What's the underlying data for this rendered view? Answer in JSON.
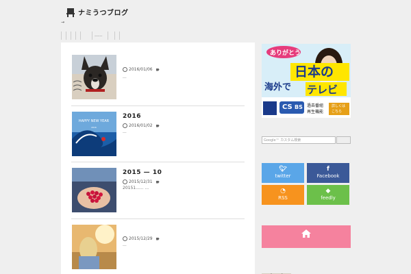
{
  "header": {
    "title": "ナミうつブログ",
    "tagline": "→",
    "nav_items": [
      "",
      "",
      "",
      "",
      "",
      "......",
      "",
      ""
    ]
  },
  "posts": [
    {
      "title": "",
      "date": "2016/01/06",
      "excerpt": "...",
      "thumb": "french-bulldog-image"
    },
    {
      "title": "2016",
      "date": "2016/01/02",
      "excerpt": "...",
      "thumb": "happy-new-year-wave-image"
    },
    {
      "title": "2015 — 10",
      "date": "2015/12/31",
      "excerpt": "20151...... ...",
      "thumb": "raspberries-in-hands-image"
    },
    {
      "title": "",
      "date": "2015/12/29",
      "excerpt": "...",
      "thumb": "blonde-woman-sunset-image"
    }
  ],
  "sidebar": {
    "ad": {
      "bubble": "ありがとう",
      "line1": "日本の",
      "line2a": "海外で",
      "line2b": "テレビ",
      "cs": "CS",
      "bs": "BS",
      "small1a": "過去番組",
      "small1b": "再生機能",
      "small2a": "詳しくは",
      "small2b": "こちら"
    },
    "search_placeholder": "Google™ カスタム検索",
    "follow": [
      {
        "label": "twitter",
        "icon": "twitter-bird-icon",
        "color": "#5aa6e8"
      },
      {
        "label": "Facebook",
        "icon": "facebook-f-icon",
        "color": "#3b5998"
      },
      {
        "label": "RSS",
        "icon": "rss-icon",
        "color": "#f7931e"
      },
      {
        "label": "feedly",
        "icon": "feedly-icon",
        "color": "#6cc04a"
      }
    ],
    "home_color": "#f5829e"
  }
}
